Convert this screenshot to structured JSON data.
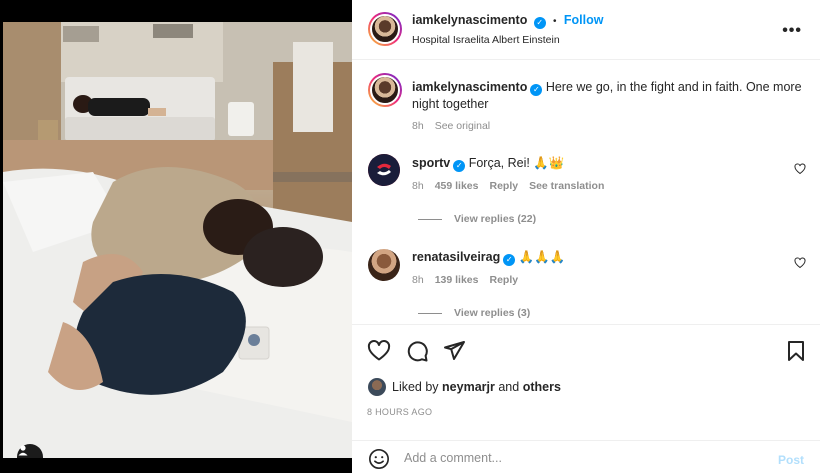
{
  "post": {
    "username": "iamkelynascimento",
    "follow_label": "Follow",
    "separator": "•",
    "location": "Hospital Israelita Albert Einstein",
    "more_icon": "more-horizontal-icon"
  },
  "caption": {
    "username": "iamkelynascimento",
    "text": "Here we go, in the fight and in faith. One more night together",
    "time": "8h",
    "see_original": "See original"
  },
  "comments": [
    {
      "username": "sportv",
      "text": "Força, Rei! 🙏👑",
      "time": "8h",
      "likes": "459 likes",
      "reply": "Reply",
      "translation": "See translation",
      "view_replies": "View replies (22)"
    },
    {
      "username": "renatasilveirag",
      "text": "🙏🙏🙏",
      "time": "8h",
      "likes": "139 likes",
      "reply": "Reply",
      "view_replies": "View replies (3)"
    }
  ],
  "likes": {
    "prefix": "Liked by",
    "user": "neymarjr",
    "conjunction": "and",
    "others": "others"
  },
  "timestamp": "8 HOURS AGO",
  "composer": {
    "placeholder": "Add a comment...",
    "post_label": "Post"
  },
  "colors": {
    "accent": "#0095f6",
    "post_disabled": "#b2dffc",
    "muted": "#8e8e8e",
    "sportv_red": "#e5283c"
  }
}
